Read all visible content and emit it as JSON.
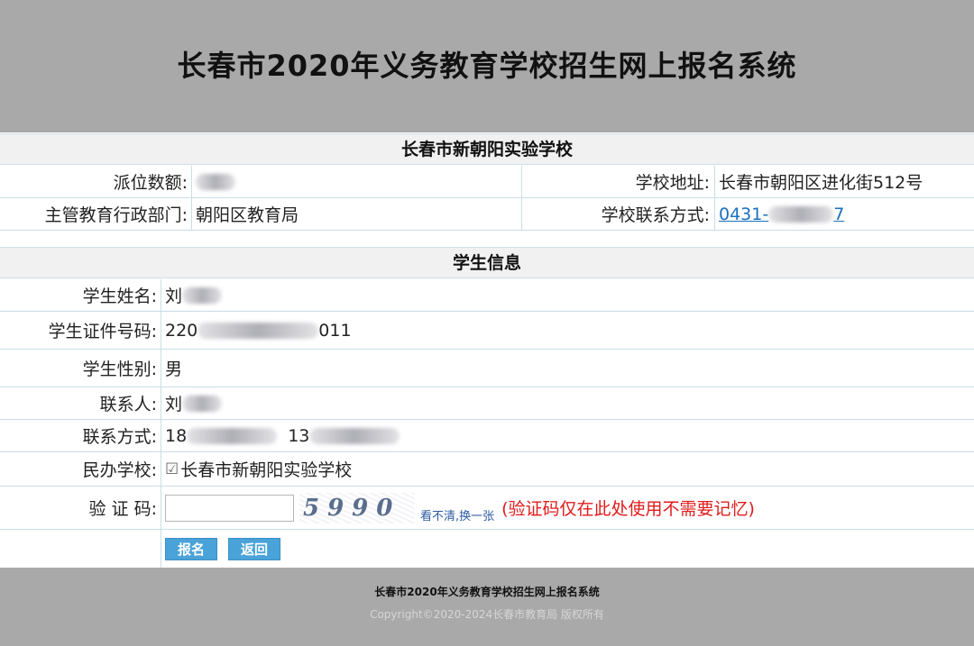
{
  "header": {
    "title": "长春市2020年义务教育学校招生网上报名系统"
  },
  "school": {
    "name": "长春市新朝阳实验学校",
    "quota_label": "派位数额:",
    "address_label": "学校地址:",
    "address": "长春市朝阳区进化街512号",
    "dept_label": "主管教育行政部门:",
    "dept": "朝阳区教育局",
    "contact_label": "学校联系方式:",
    "contact_prefix": "0431-",
    "contact_suffix": "7"
  },
  "student": {
    "section_title": "学生信息",
    "name_label": "学生姓名:",
    "name_prefix": "刘",
    "id_label": "学生证件号码:",
    "id_prefix": "220",
    "id_suffix": "011",
    "gender_label": "学生性别:",
    "gender": "男",
    "contact_person_label": "联系人:",
    "contact_person_prefix": "刘",
    "phone_label": "联系方式:",
    "phone1_prefix": "18",
    "phone2_prefix": "13",
    "private_school_label": "民办学校:",
    "private_school_check": "☑",
    "private_school_name": "长春市新朝阳实验学校",
    "captcha_label": "验 证 码:",
    "captcha_text": "5990",
    "captcha_refresh": "看不清,换一张",
    "captcha_note": "(验证码仅在此处使用不需要记忆)"
  },
  "buttons": {
    "submit": "报名",
    "back": "返回"
  },
  "footer": {
    "title": "长春市2020年义务教育学校招生网上报名系统",
    "copyright": "Copyright©2020-2024长春市教育局 版权所有"
  }
}
